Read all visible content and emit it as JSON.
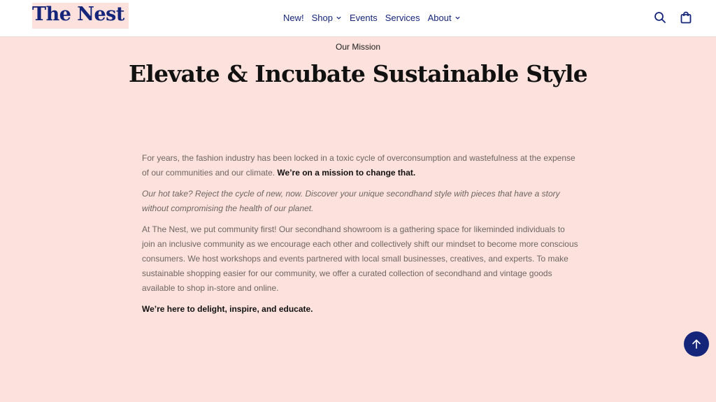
{
  "header": {
    "logo_text": "The Nest",
    "nav": [
      {
        "label": "New!",
        "has_dropdown": false
      },
      {
        "label": "Shop",
        "has_dropdown": true
      },
      {
        "label": "Events",
        "has_dropdown": false
      },
      {
        "label": "Services",
        "has_dropdown": false
      },
      {
        "label": "About",
        "has_dropdown": true
      }
    ],
    "icons": [
      "search-icon",
      "shopping-bag-icon"
    ]
  },
  "main": {
    "eyebrow": "Our Mission",
    "headline": "Elevate & Incubate Sustainable Style",
    "paragraphs": {
      "p1_text": "For years, the fashion industry has been locked in a toxic cycle of overconsumption and wastefulness at the expense of our communities and our climate. ",
      "p1_bold": "We’re on a mission to change that.",
      "p2_italic": "Our hot take? Reject the cycle of new, now. Discover your unique secondhand style with pieces that have a story without compromising the health of our planet.",
      "p3_text": "At The Nest, we put community first! Our secondhand showroom is a gathering space for likeminded individuals to join an inclusive community as we encourage each other and collectively shift our mindset to become more conscious consumers. We host workshops and events partnered with local small businesses, creatives, and experts. To make sustainable shopping easier for our community, we offer a curated collection of secondhand and vintage goods available to shop in-store and online.",
      "p4_bold": "We’re here to delight, inspire, and educate."
    }
  },
  "colors": {
    "brand": "#15257a",
    "background": "#fde1dc",
    "header_bg": "#ffffff"
  },
  "scroll_top_icon": "arrow-up-icon"
}
